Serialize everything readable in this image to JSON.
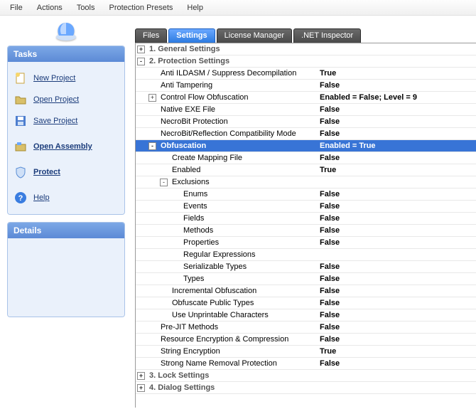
{
  "menu": [
    "File",
    "Actions",
    "Tools",
    "Protection Presets",
    "Help"
  ],
  "sidebar": {
    "tasks_title": "Tasks",
    "details_title": "Details",
    "items": [
      {
        "label": "New Project",
        "icon": "new",
        "bold": false
      },
      {
        "label": "Open Project",
        "icon": "open",
        "bold": false
      },
      {
        "label": "Save Project",
        "icon": "save",
        "bold": false
      },
      {
        "label": "Open Assembly",
        "icon": "assembly",
        "bold": true
      },
      {
        "label": "Protect",
        "icon": "shield",
        "bold": true
      },
      {
        "label": "Help",
        "icon": "help",
        "bold": false
      }
    ]
  },
  "tabs": [
    "Files",
    "Settings",
    "License Manager",
    ".NET Inspector"
  ],
  "active_tab": 1,
  "grid": [
    {
      "type": "cat",
      "exp": "+",
      "indent": 0,
      "key": "1. General Settings",
      "val": ""
    },
    {
      "type": "cat",
      "exp": "-",
      "indent": 0,
      "key": "2. Protection Settings",
      "val": ""
    },
    {
      "type": "row",
      "exp": "",
      "indent": 1,
      "key": "Anti ILDASM / Suppress Decompilation",
      "val": "True"
    },
    {
      "type": "row",
      "exp": "",
      "indent": 1,
      "key": "Anti Tampering",
      "val": "False"
    },
    {
      "type": "row",
      "exp": "+",
      "indent": 1,
      "key": "Control Flow Obfuscation",
      "val": "Enabled = False; Level = 9"
    },
    {
      "type": "row",
      "exp": "",
      "indent": 1,
      "key": "Native EXE File",
      "val": "False"
    },
    {
      "type": "row",
      "exp": "",
      "indent": 1,
      "key": "NecroBit Protection",
      "val": "False"
    },
    {
      "type": "row",
      "exp": "",
      "indent": 1,
      "key": "NecroBit/Reflection Compatibility Mode",
      "val": "False"
    },
    {
      "type": "sel",
      "exp": "-",
      "indent": 1,
      "key": "Obfuscation",
      "val": "Enabled = True"
    },
    {
      "type": "row",
      "exp": "",
      "indent": 2,
      "key": "Create Mapping File",
      "val": "False"
    },
    {
      "type": "row",
      "exp": "",
      "indent": 2,
      "key": "Enabled",
      "val": "True"
    },
    {
      "type": "row",
      "exp": "-",
      "indent": 2,
      "key": "Exclusions",
      "val": ""
    },
    {
      "type": "row",
      "exp": "",
      "indent": 3,
      "key": "Enums",
      "val": "False"
    },
    {
      "type": "row",
      "exp": "",
      "indent": 3,
      "key": "Events",
      "val": "False"
    },
    {
      "type": "row",
      "exp": "",
      "indent": 3,
      "key": "Fields",
      "val": "False"
    },
    {
      "type": "row",
      "exp": "",
      "indent": 3,
      "key": "Methods",
      "val": "False"
    },
    {
      "type": "row",
      "exp": "",
      "indent": 3,
      "key": "Properties",
      "val": "False"
    },
    {
      "type": "row",
      "exp": "",
      "indent": 3,
      "key": "Regular Expressions",
      "val": ""
    },
    {
      "type": "row",
      "exp": "",
      "indent": 3,
      "key": "Serializable Types",
      "val": "False"
    },
    {
      "type": "row",
      "exp": "",
      "indent": 3,
      "key": "Types",
      "val": "False"
    },
    {
      "type": "row",
      "exp": "",
      "indent": 2,
      "key": "Incremental Obfuscation",
      "val": "False"
    },
    {
      "type": "row",
      "exp": "",
      "indent": 2,
      "key": "Obfuscate Public Types",
      "val": "False"
    },
    {
      "type": "row",
      "exp": "",
      "indent": 2,
      "key": "Use Unprintable Characters",
      "val": "False"
    },
    {
      "type": "row",
      "exp": "",
      "indent": 1,
      "key": "Pre-JIT Methods",
      "val": "False"
    },
    {
      "type": "row",
      "exp": "",
      "indent": 1,
      "key": "Resource Encryption & Compression",
      "val": "False"
    },
    {
      "type": "row",
      "exp": "",
      "indent": 1,
      "key": "String Encryption",
      "val": "True"
    },
    {
      "type": "row",
      "exp": "",
      "indent": 1,
      "key": "Strong Name Removal Protection",
      "val": "False"
    },
    {
      "type": "cat",
      "exp": "+",
      "indent": 0,
      "key": "3. Lock Settings",
      "val": ""
    },
    {
      "type": "cat",
      "exp": "+",
      "indent": 0,
      "key": "4. Dialog Settings",
      "val": ""
    }
  ]
}
